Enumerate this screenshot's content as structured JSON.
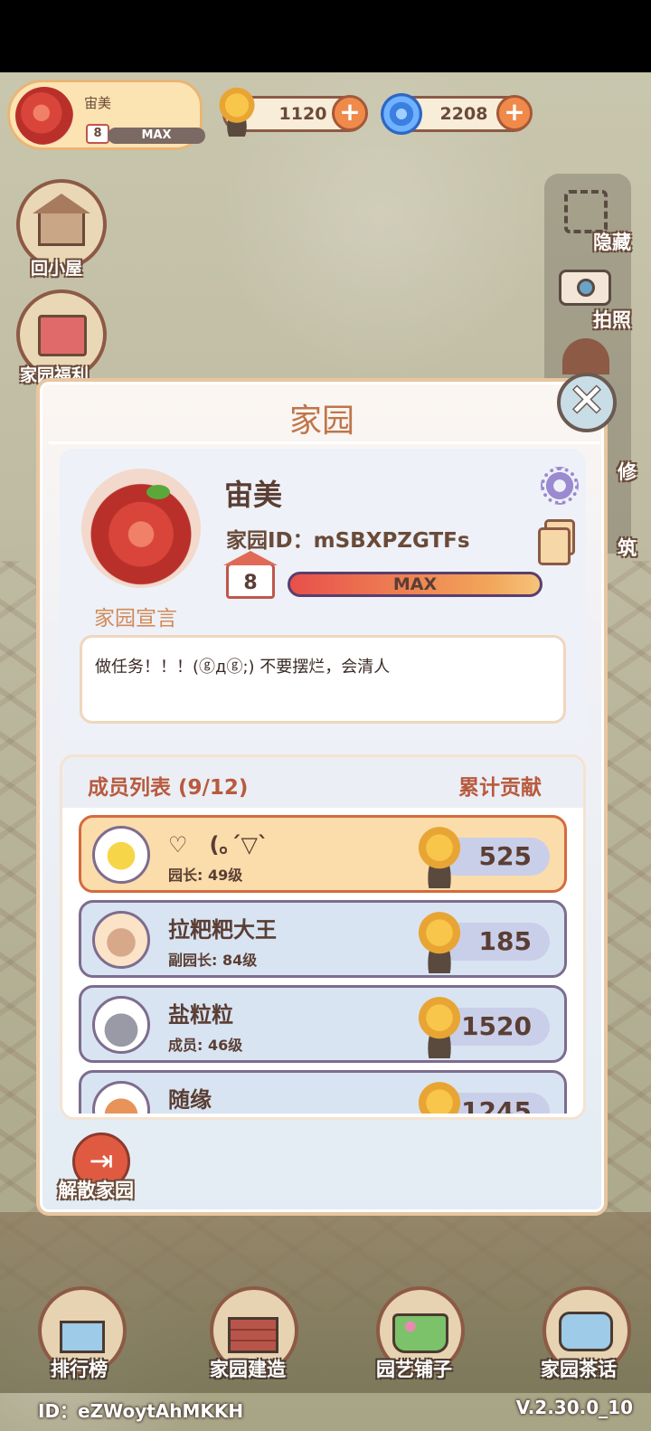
{
  "profile": {
    "name": "宙美",
    "level": "8",
    "level_bar": "MAX"
  },
  "resources": {
    "snail_value": "1120",
    "swirl_value": "2208"
  },
  "left_buttons": {
    "cabin": "回小屋",
    "benefits": "家园福利"
  },
  "right_buttons": {
    "hide": "隐藏",
    "photo": "拍照",
    "repair": "修",
    "build": "筑"
  },
  "modal": {
    "title": "家园",
    "garden_name": "宙美",
    "garden_id": "家园ID：mSBXPZGTFs",
    "level": "8",
    "level_bar": "MAX",
    "manifesto_label": "家园宣言",
    "manifesto_text": "做任务！！！(ⓖдⓖ;) 不要摆烂，会清人",
    "members_title": "成员列表 (9/12)",
    "members_contrib_label": "累计贡献",
    "members": [
      {
        "name": "♡　(｡´▽`",
        "role": "园长: 49级",
        "score": "525"
      },
      {
        "name": "拉粑粑大王",
        "role": "副园长: 84级",
        "score": "185"
      },
      {
        "name": "盐粒粒",
        "role": "成员: 46级",
        "score": "1520"
      },
      {
        "name": "随缘",
        "role": "",
        "score": "1245"
      }
    ],
    "disband_label": "解散家园"
  },
  "dock": {
    "ranking": "排行榜",
    "build": "家园建造",
    "shop": "园艺铺子",
    "chat": "家园茶话"
  },
  "footer": {
    "id": "ID：eZWoytAhMKKH",
    "version": "V.2.30.0_10"
  },
  "colors": {
    "accent": "#c0754a",
    "leader_row": "#fbdcab",
    "member_row": "#d9e4f2",
    "plus": "#f08a4a"
  }
}
